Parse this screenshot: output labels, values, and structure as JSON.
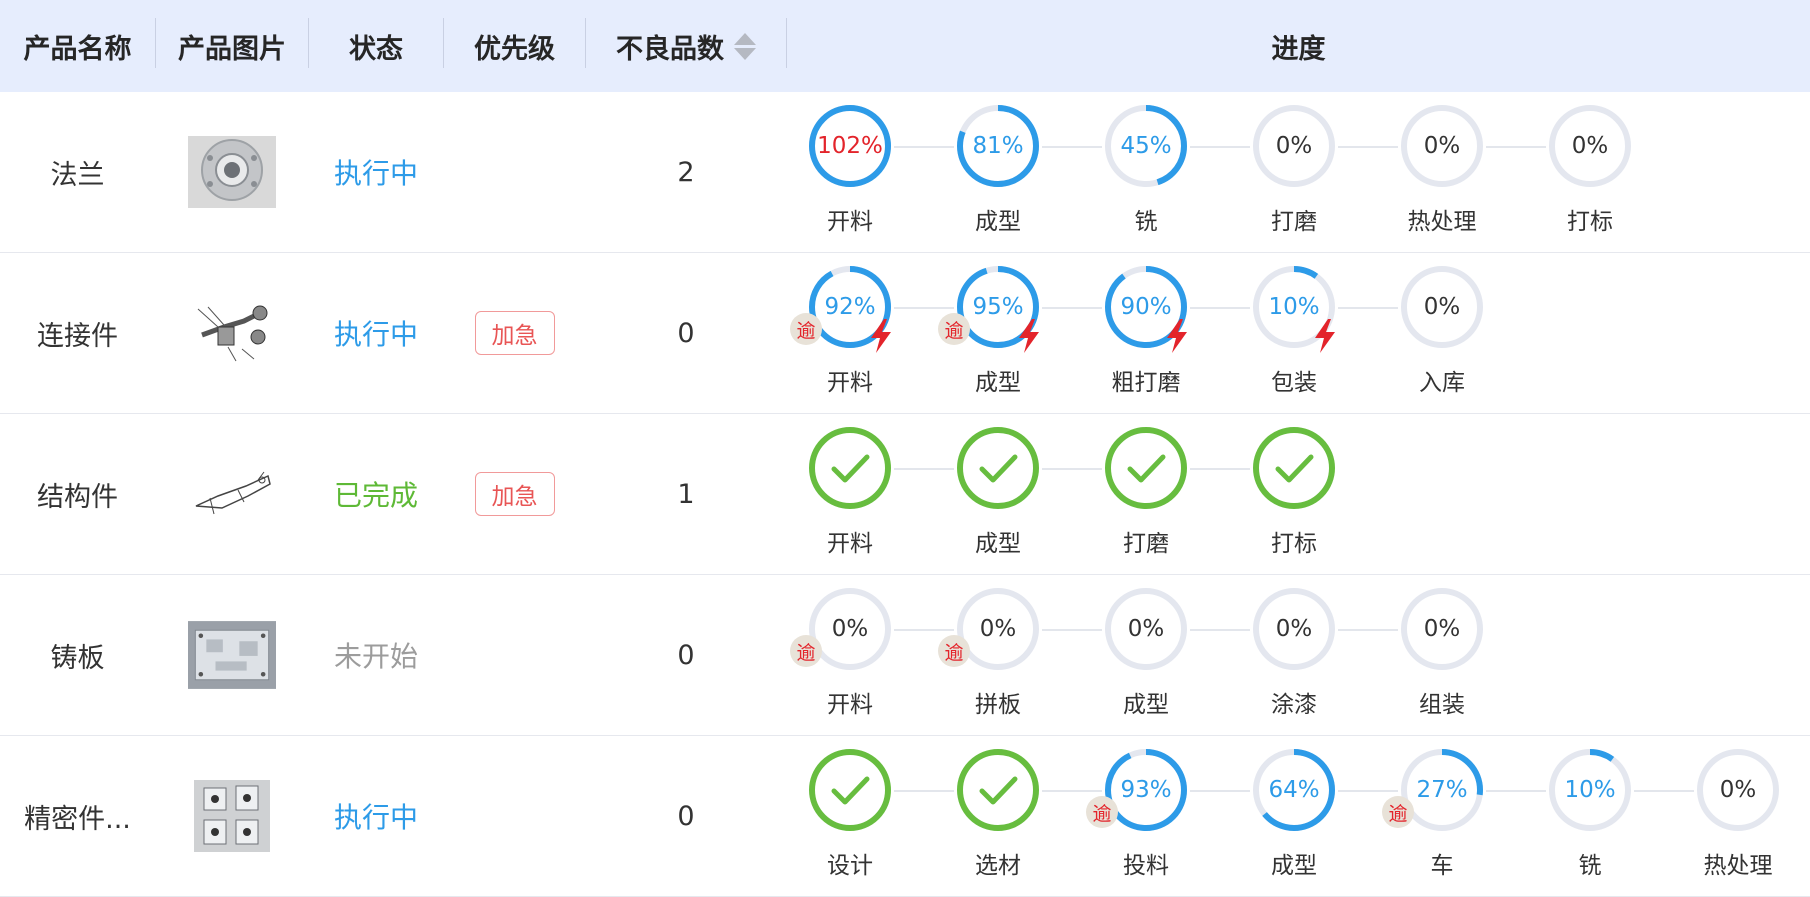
{
  "header": {
    "product_name": "产品名称",
    "product_image": "产品图片",
    "status": "状态",
    "priority": "优先级",
    "defects": "不良品数",
    "progress": "进度"
  },
  "colors": {
    "header_bg": "#e6edfd",
    "ring_active": "#2d9be8",
    "ring_track": "#e4e7ef",
    "ring_done": "#67bd3f",
    "over_100": "#e3242b",
    "urgent_tag": "#e85555"
  },
  "rows": [
    {
      "name": "法兰",
      "image_icon": "flange-photo",
      "status": "执行中",
      "status_kind": "running",
      "priority": "",
      "defects": "2",
      "steps": [
        {
          "label": "开料",
          "pct_text": "102%",
          "pct": 102,
          "done": false,
          "overdue": "",
          "urgent": false
        },
        {
          "label": "成型",
          "pct_text": "81%",
          "pct": 81,
          "done": false,
          "overdue": "",
          "urgent": false
        },
        {
          "label": "铣",
          "pct_text": "45%",
          "pct": 45,
          "done": false,
          "overdue": "",
          "urgent": false
        },
        {
          "label": "打磨",
          "pct_text": "0%",
          "pct": 0,
          "done": false,
          "overdue": "",
          "urgent": false
        },
        {
          "label": "热处理",
          "pct_text": "0%",
          "pct": 0,
          "done": false,
          "overdue": "",
          "urgent": false
        },
        {
          "label": "打标",
          "pct_text": "0%",
          "pct": 0,
          "done": false,
          "overdue": "",
          "urgent": false
        }
      ]
    },
    {
      "name": "连接件",
      "image_icon": "connector-drawing",
      "status": "执行中",
      "status_kind": "running",
      "priority": "加急",
      "defects": "0",
      "steps": [
        {
          "label": "开料",
          "pct_text": "92%",
          "pct": 92,
          "done": false,
          "overdue": "逾",
          "urgent": true
        },
        {
          "label": "成型",
          "pct_text": "95%",
          "pct": 95,
          "done": false,
          "overdue": "逾",
          "urgent": true
        },
        {
          "label": "粗打磨",
          "pct_text": "90%",
          "pct": 90,
          "done": false,
          "overdue": "",
          "urgent": true
        },
        {
          "label": "包装",
          "pct_text": "10%",
          "pct": 10,
          "done": false,
          "overdue": "",
          "urgent": true
        },
        {
          "label": "入库",
          "pct_text": "0%",
          "pct": 0,
          "done": false,
          "overdue": "",
          "urgent": false
        }
      ]
    },
    {
      "name": "结构件",
      "image_icon": "structure-drawing",
      "status": "已完成",
      "status_kind": "done",
      "priority": "加急",
      "defects": "1",
      "steps": [
        {
          "label": "开料",
          "pct_text": "",
          "pct": 100,
          "done": true,
          "overdue": "",
          "urgent": false
        },
        {
          "label": "成型",
          "pct_text": "",
          "pct": 100,
          "done": true,
          "overdue": "",
          "urgent": false
        },
        {
          "label": "打磨",
          "pct_text": "",
          "pct": 100,
          "done": true,
          "overdue": "",
          "urgent": false
        },
        {
          "label": "打标",
          "pct_text": "",
          "pct": 100,
          "done": true,
          "overdue": "",
          "urgent": false
        }
      ]
    },
    {
      "name": "铸板",
      "image_icon": "casting-plate-photo",
      "status": "未开始",
      "status_kind": "pending",
      "priority": "",
      "defects": "0",
      "steps": [
        {
          "label": "开料",
          "pct_text": "0%",
          "pct": 0,
          "done": false,
          "overdue": "逾",
          "urgent": false
        },
        {
          "label": "拼板",
          "pct_text": "0%",
          "pct": 0,
          "done": false,
          "overdue": "逾",
          "urgent": false
        },
        {
          "label": "成型",
          "pct_text": "0%",
          "pct": 0,
          "done": false,
          "overdue": "",
          "urgent": false
        },
        {
          "label": "涂漆",
          "pct_text": "0%",
          "pct": 0,
          "done": false,
          "overdue": "",
          "urgent": false
        },
        {
          "label": "组装",
          "pct_text": "0%",
          "pct": 0,
          "done": false,
          "overdue": "",
          "urgent": false
        }
      ]
    },
    {
      "name": "精密件...",
      "image_icon": "precision-parts-photo",
      "status": "执行中",
      "status_kind": "running",
      "priority": "",
      "defects": "0",
      "steps": [
        {
          "label": "设计",
          "pct_text": "",
          "pct": 100,
          "done": true,
          "overdue": "",
          "urgent": false
        },
        {
          "label": "选材",
          "pct_text": "",
          "pct": 100,
          "done": true,
          "overdue": "",
          "urgent": false
        },
        {
          "label": "投料",
          "pct_text": "93%",
          "pct": 93,
          "done": false,
          "overdue": "逾",
          "urgent": false
        },
        {
          "label": "成型",
          "pct_text": "64%",
          "pct": 64,
          "done": false,
          "overdue": "",
          "urgent": false
        },
        {
          "label": "车",
          "pct_text": "27%",
          "pct": 27,
          "done": false,
          "overdue": "逾",
          "urgent": false
        },
        {
          "label": "铣",
          "pct_text": "10%",
          "pct": 10,
          "done": false,
          "overdue": "",
          "urgent": false
        },
        {
          "label": "热处理",
          "pct_text": "0%",
          "pct": 0,
          "done": false,
          "overdue": "",
          "urgent": false
        }
      ]
    }
  ]
}
